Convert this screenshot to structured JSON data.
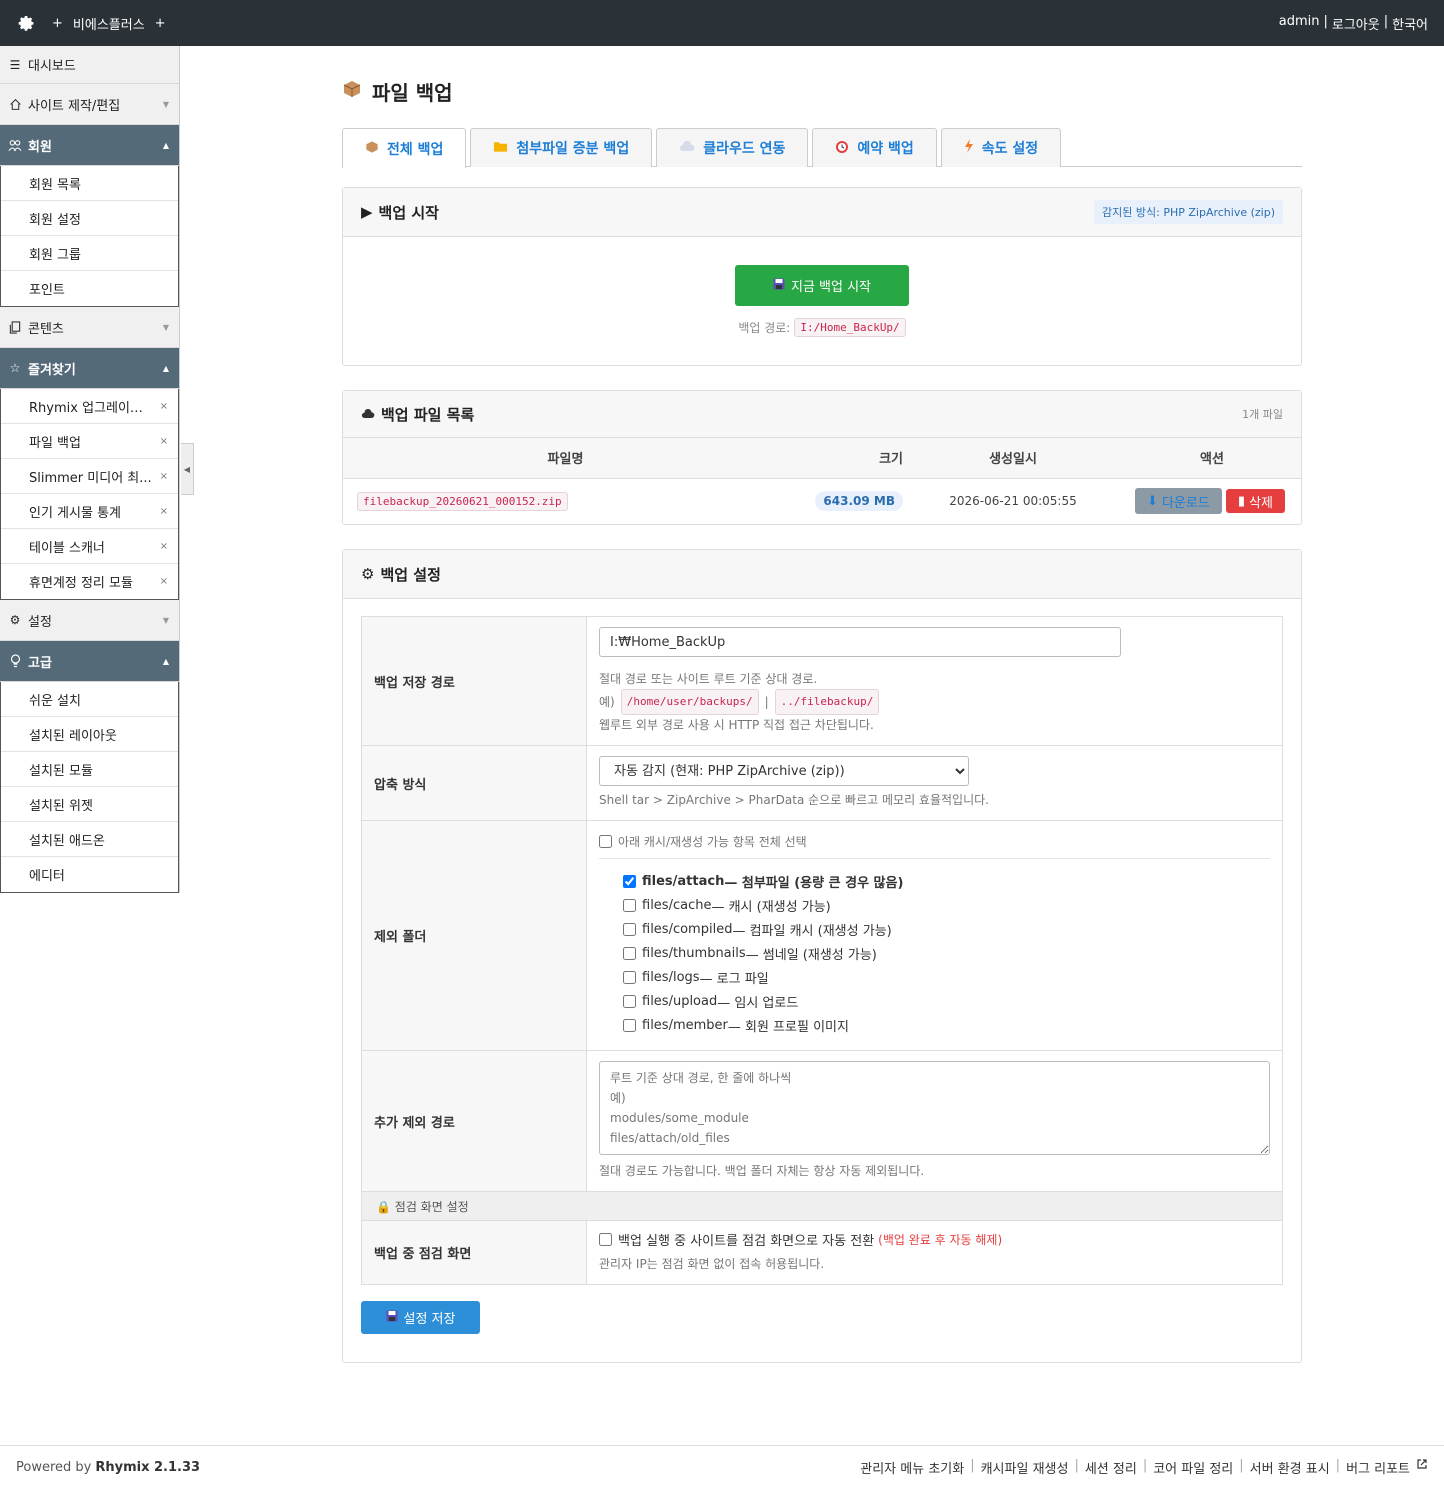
{
  "topbar": {
    "site_name": "비에스플러스",
    "plus": "+",
    "user": "admin",
    "logout": "로그아웃",
    "language": "한국어",
    "sep": "|"
  },
  "sidebar": {
    "dashboard": "대시보드",
    "site_edit": "사이트 제작/편집",
    "member": {
      "title": "회원",
      "items": [
        "회원 목록",
        "회원 설정",
        "회원 그룹",
        "포인트"
      ]
    },
    "contents": "콘텐츠",
    "favorites": {
      "title": "즐겨찾기",
      "items": [
        "Rhymix 업그레이드...",
        "파일 백업",
        "Slimmer 미디어 최...",
        "인기 게시물 통계",
        "테이블 스캐너",
        "휴면계정 정리 모듈"
      ],
      "remove_glyph": "×"
    },
    "settings": "설정",
    "advanced": {
      "title": "고급",
      "items": [
        "쉬운 설치",
        "설치된 레이아웃",
        "설치된 모듈",
        "설치된 위젯",
        "설치된 애드온",
        "에디터"
      ]
    }
  },
  "page": {
    "title": "파일 백업"
  },
  "tabs": [
    "전체 백업",
    "첨부파일 증분 백업",
    "클라우드 연동",
    "예약 백업",
    "속도 설정"
  ],
  "backup_start": {
    "title": "백업 시작",
    "detected": "감지된 방식: PHP ZipArchive (zip)",
    "button": "지금 백업 시작",
    "path_label": "백업 경로:",
    "path": "I:/Home_BackUp/"
  },
  "backup_list": {
    "title": "백업 파일 목록",
    "count": "1개 파일",
    "columns": [
      "파일명",
      "크기",
      "생성일시",
      "액션"
    ],
    "rows": [
      {
        "name": "filebackup_20260621_000152.zip",
        "size": "643.09 MB",
        "created": "2026-06-21 00:05:55"
      }
    ],
    "download": "다운로드",
    "delete": "삭제"
  },
  "settings": {
    "title": "백업 설정",
    "path": {
      "label": "백업 저장 경로",
      "value": "I:₩Home_BackUp",
      "help1": "절대 경로 또는 사이트 루트 기준 상대 경로.",
      "help2_prefix": "예)",
      "ex1": "/home/user/backups/",
      "ex_sep": "|",
      "ex2": "../filebackup/",
      "help3": "웹루트 외부 경로 사용 시 HTTP 직접 접근 차단됩니다."
    },
    "compress": {
      "label": "압축 방식",
      "selected": "자동 감지 (현재: PHP ZipArchive (zip))",
      "help": "Shell tar > ZipArchive > PharData 순으로 빠르고 메모리 효율적입니다."
    },
    "exclude": {
      "label": "제외 폴더",
      "select_all": "아래 캐시/재생성 가능 항목 전체 선택",
      "options": [
        {
          "path": "files/attach",
          "desc": " — 첨부파일 (용량 큰 경우 많음)",
          "checked": true
        },
        {
          "path": "files/cache",
          "desc": " — 캐시 (재생성 가능)",
          "checked": false
        },
        {
          "path": "files/compiled",
          "desc": " — 컴파일 캐시 (재생성 가능)",
          "checked": false
        },
        {
          "path": "files/thumbnails",
          "desc": " — 썸네일 (재생성 가능)",
          "checked": false
        },
        {
          "path": "files/logs",
          "desc": " — 로그 파일",
          "checked": false
        },
        {
          "path": "files/upload",
          "desc": " — 임시 업로드",
          "checked": false
        },
        {
          "path": "files/member",
          "desc": " — 회원 프로필 이미지",
          "checked": false
        }
      ]
    },
    "extra_exclude": {
      "label": "추가 제외 경로",
      "placeholder": "루트 기준 상대 경로, 한 줄에 하나씩\n예)\nmodules/some_module\nfiles/attach/old_files",
      "help": "절대 경로도 가능합니다. 백업 폴더 자체는 항상 자동 제외됩니다."
    },
    "maintenance_section": "점검 화면 설정",
    "maintenance": {
      "label": "백업 중 점검 화면",
      "text": "백업 실행 중 사이트를 점검 화면으로 자동 전환",
      "note": "(백업 완료 후 자동 해제)",
      "help": "관리자 IP는 점검 화면 없이 접속 허용됩니다."
    },
    "save": "설정 저장"
  },
  "footer": {
    "powered": "Powered by",
    "product": "Rhymix 2.1.33",
    "links": [
      "관리자 메뉴 초기화",
      "캐시파일 재생성",
      "세션 정리",
      "코어 파일 정리",
      "서버 환경 표시",
      "버그 리포트"
    ],
    "sep": "|"
  },
  "colors": {
    "topbar": "#2b3237",
    "sidebar_open": "#546a78",
    "primary": "#1c7ed6",
    "success": "#28a745",
    "danger": "#e53e3e",
    "save": "#2d8fd8"
  }
}
